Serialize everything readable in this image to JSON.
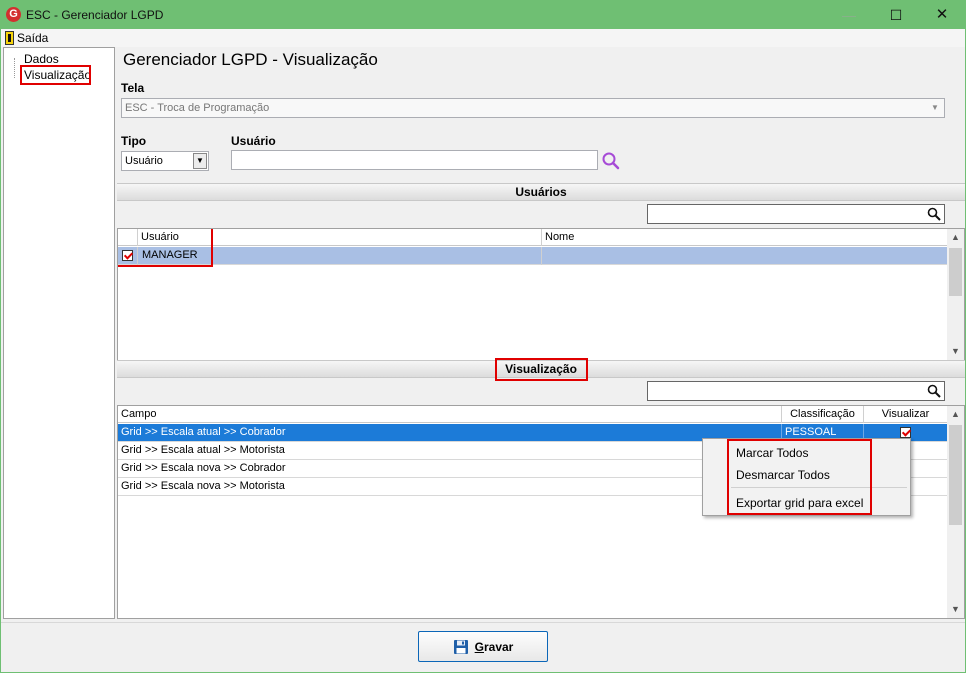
{
  "window": {
    "title": "ESC - Gerenciador LGPD",
    "app_icon_letter": "G",
    "minimize_glyph": "—",
    "maximize_glyph": "☐",
    "close_glyph": "✕"
  },
  "menu": {
    "exit_label": "Saída"
  },
  "sidebar": {
    "items": [
      {
        "label": "Dados"
      },
      {
        "label": "Visualização",
        "highlighted": true
      }
    ]
  },
  "page": {
    "title": "Gerenciador LGPD - Visualização",
    "tela_label": "Tela",
    "tela_value": "ESC - Troca de Programação",
    "tipo_label": "Tipo",
    "tipo_value": "Usuário",
    "usuario_label": "Usuário",
    "usuario_value": ""
  },
  "users_section": {
    "title": "Usuários",
    "filter_value": "",
    "columns": [
      "Usuário",
      "Nome"
    ],
    "rows": [
      {
        "checked": true,
        "usuario": "MANAGER",
        "nome": ""
      }
    ]
  },
  "vis_section": {
    "title": "Visualização",
    "filter_value": "",
    "columns": [
      "Campo",
      "Classificação",
      "Visualizar"
    ],
    "rows": [
      {
        "campo": "Grid >> Escala atual >> Cobrador",
        "classificacao": "PESSOAL",
        "visualizar": true,
        "selected": true
      },
      {
        "campo": "Grid >> Escala atual >> Motorista",
        "classificacao": "",
        "visualizar": false,
        "selected": false
      },
      {
        "campo": "Grid >> Escala nova >> Cobrador",
        "classificacao": "",
        "visualizar": false,
        "selected": false
      },
      {
        "campo": "Grid >> Escala nova >> Motorista",
        "classificacao": "",
        "visualizar": false,
        "selected": false
      }
    ]
  },
  "context_menu": {
    "items": [
      "Marcar Todos",
      "Desmarcar Todos",
      "Exportar grid para excel"
    ]
  },
  "footer": {
    "save_prefix": "G",
    "save_rest": "ravar"
  },
  "colors": {
    "titlebar": "#6fbf73",
    "highlight_box": "#e00000",
    "selected_row": "#1c7bd8",
    "selected_user_row": "#a9bfe4"
  }
}
